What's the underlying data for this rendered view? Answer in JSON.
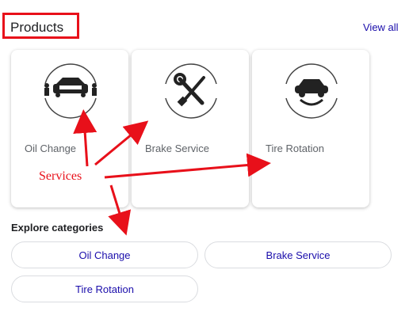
{
  "header": {
    "title": "Products",
    "view_all": "View all"
  },
  "cards": [
    {
      "label": "Oil Change",
      "icon": "car-mechanic-icon"
    },
    {
      "label": "Brake Service",
      "icon": "wrench-screwdriver-icon"
    },
    {
      "label": "Tire Rotation",
      "icon": "car-rotation-icon"
    }
  ],
  "explore": {
    "heading": "Explore categories",
    "chips": [
      "Oil Change",
      "Brake Service",
      "Tire Rotation"
    ]
  },
  "annotation": {
    "label": "Services",
    "color": "#e8101a"
  },
  "colors": {
    "link": "#1a0dab",
    "annotation": "#e8101a"
  }
}
